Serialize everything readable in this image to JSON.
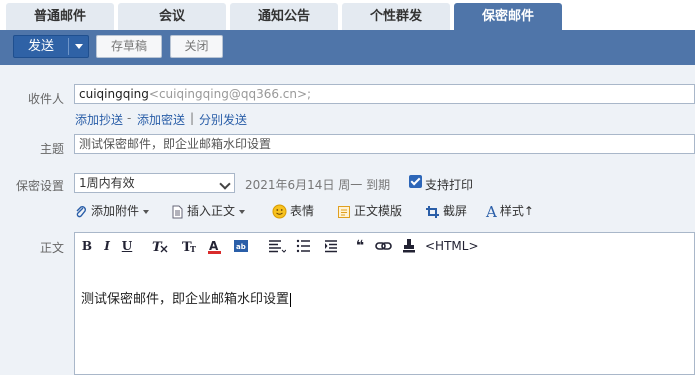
{
  "tabs": [
    {
      "label": "普通邮件"
    },
    {
      "label": "会议"
    },
    {
      "label": "通知公告"
    },
    {
      "label": "个性群发"
    },
    {
      "label": "保密邮件",
      "active": true
    }
  ],
  "toolbar": {
    "send_label": "发送",
    "draft_label": "存草稿",
    "close_label": "关闭"
  },
  "form": {
    "recipient_label": "收件人",
    "recipient_name": "cuiqingqing",
    "recipient_address": "<cuiqingqing@qq366.cn>;",
    "links": {
      "add_cc": "添加抄送",
      "dash": "-",
      "add_bcc": "添加密送",
      "pipe": "|",
      "separate_send": "分别发送"
    },
    "subject_label": "主题",
    "subject_value": "测试保密邮件，即企业邮箱水印设置",
    "secret_label": "保密设置",
    "secret_option": "1周内有效",
    "expire_text": "2021年6月14日 周一 到期",
    "print_label": "支持打印",
    "print_checked": true
  },
  "tools": {
    "attach": "添加附件",
    "insert_body": "插入正文",
    "emoji": "表情",
    "template": "正文模版",
    "screenshot": "截屏",
    "style": "样式↑"
  },
  "editor": {
    "body_label": "正文",
    "bold": "B",
    "italic": "I",
    "underline": "U",
    "html_toggle": "<HTML>",
    "content": "测试保密邮件，即企业邮箱水印设置"
  },
  "colors": {
    "accent": "#4f75a9",
    "send_button": "#2f62a6",
    "link": "#2a5ea8"
  }
}
